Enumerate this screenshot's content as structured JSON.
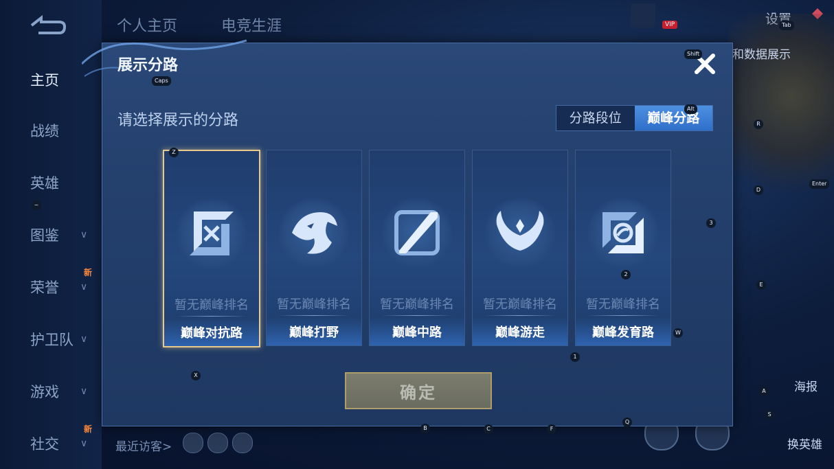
{
  "background": {
    "nav_items": [
      {
        "label": "主页",
        "active": true,
        "chevron": false,
        "new": false
      },
      {
        "label": "战绩",
        "active": false,
        "chevron": false,
        "new": false
      },
      {
        "label": "英雄",
        "active": false,
        "chevron": false,
        "new": false
      },
      {
        "label": "图鉴",
        "active": false,
        "chevron": true,
        "new": false
      },
      {
        "label": "荣誉",
        "active": false,
        "chevron": true,
        "new": true
      },
      {
        "label": "护卫队",
        "active": false,
        "chevron": true,
        "new": false
      },
      {
        "label": "游戏",
        "active": false,
        "chevron": true,
        "new": false
      },
      {
        "label": "社交",
        "active": false,
        "chevron": true,
        "new": true
      }
    ],
    "new_badge": "新",
    "top_tabs": [
      "个人主页",
      "电竞生涯"
    ],
    "vip_label": "VIP",
    "settings_label": "设置",
    "data_display_label": "和数据展示",
    "poster_label": "海报",
    "swap_hero_label": "换英雄",
    "recent_visitors_label": "最近访客>"
  },
  "dialog": {
    "title": "展示分路",
    "subtitle": "请选择展示的分路",
    "tabs": [
      {
        "label": "分路段位",
        "active": false
      },
      {
        "label": "巅峰分路",
        "active": true
      }
    ],
    "cards": [
      {
        "name": "巅峰对抗路",
        "rank": "暂无巅峰排名",
        "icon": "clash-lane-icon",
        "selected": true
      },
      {
        "name": "巅峰打野",
        "rank": "暂无巅峰排名",
        "icon": "jungle-dragon-icon",
        "selected": false
      },
      {
        "name": "巅峰中路",
        "rank": "暂无巅峰排名",
        "icon": "mid-lane-icon",
        "selected": false
      },
      {
        "name": "巅峰游走",
        "rank": "暂无巅峰排名",
        "icon": "roam-wings-icon",
        "selected": false
      },
      {
        "name": "巅峰发育路",
        "rank": "暂无巅峰排名",
        "icon": "farm-lane-icon",
        "selected": false
      }
    ],
    "confirm_label": "确定"
  },
  "hotkeys": {
    "caps": "Caps",
    "shift": "Shift",
    "alt": "Alt",
    "tab": "Tab",
    "enter": "Enter",
    "z": "Z",
    "x": "X",
    "r": "R",
    "d": "D",
    "three": "3",
    "two": "2",
    "w": "W",
    "e": "E",
    "one": "1",
    "a": "A",
    "s": "S",
    "b": "B",
    "c": "C",
    "f": "F",
    "q": "Q",
    "tilde": "~"
  },
  "colors": {
    "accent": "#2f6fca",
    "selected_border": "#e8c98e",
    "dialog_bg": "#24406d"
  }
}
